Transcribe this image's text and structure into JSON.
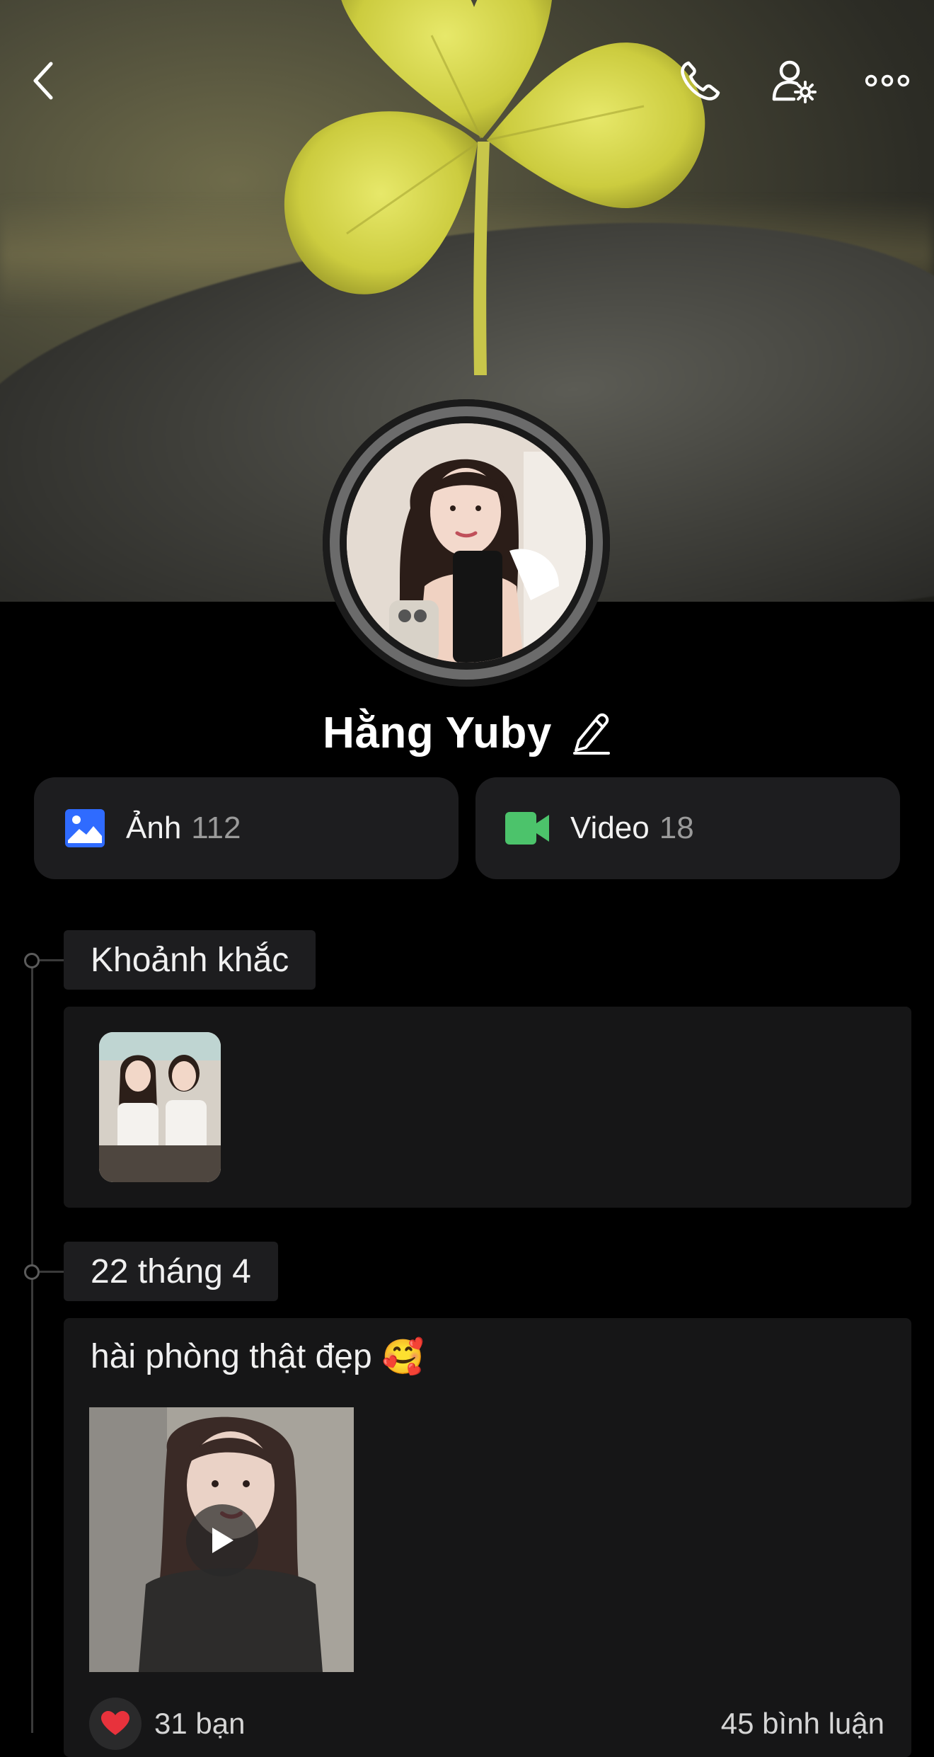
{
  "profile": {
    "name": "Hằng Yuby"
  },
  "media": {
    "photos": {
      "label": "Ảnh",
      "count": "112"
    },
    "videos": {
      "label": "Video",
      "count": "18"
    }
  },
  "timeline": {
    "moments_label": "Khoảnh khắc",
    "post_date": "22 tháng 4",
    "post_text": "hài phòng thật đẹp",
    "post_emoji": "🥰",
    "reactions": "31 bạn",
    "comments": "45 bình luận"
  },
  "colors": {
    "photo_icon": "#2f6bff",
    "video_icon": "#4cc36b",
    "heart": "#e8323c"
  }
}
